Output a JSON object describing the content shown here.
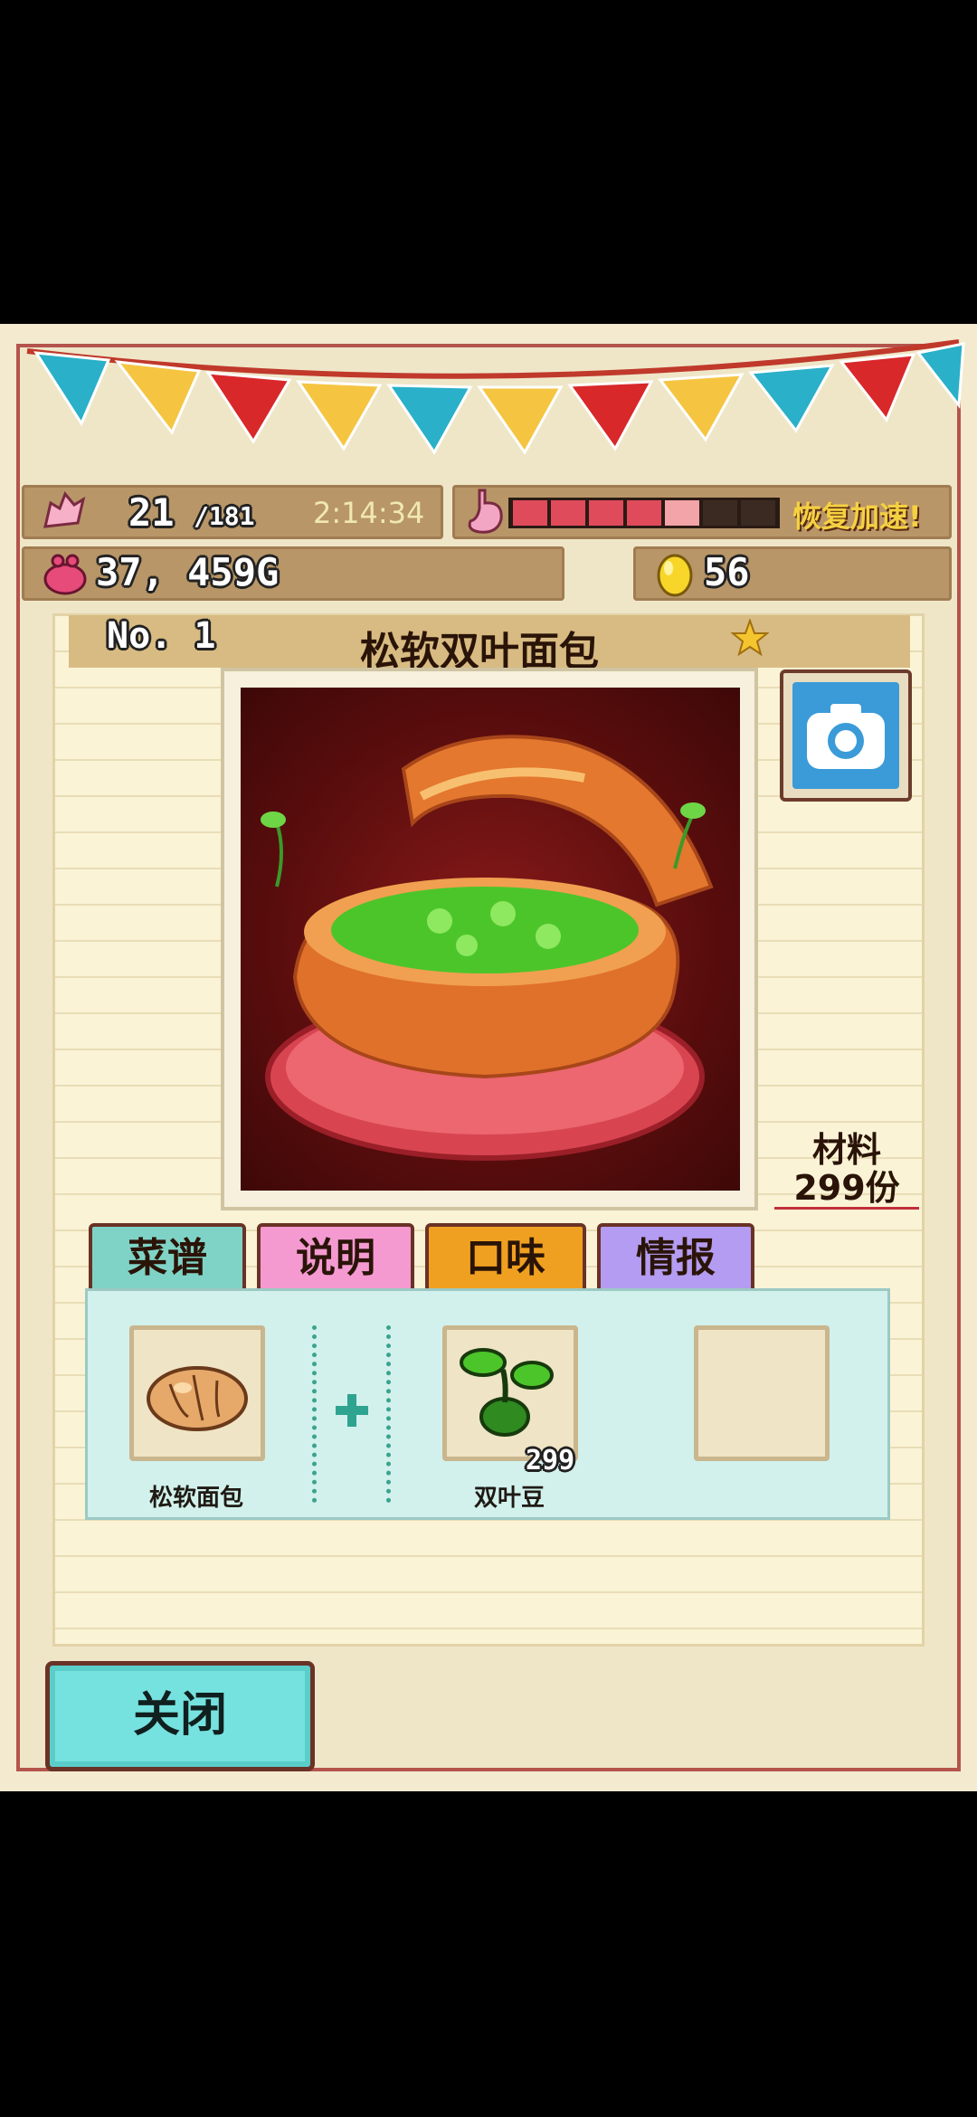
{
  "status": {
    "stamina_current": "21",
    "stamina_max": "/181",
    "timer": "2:14:34",
    "stomach_label": "恢复加速!",
    "stomach_level": 0.75,
    "money": "37, 459G",
    "eggs": "56"
  },
  "recipe": {
    "number": "No. 1",
    "name": "松软双叶面包",
    "materials_label": "材料",
    "materials_count": "299份"
  },
  "tabs": [
    {
      "label": "菜谱",
      "color": "#7fd3c6"
    },
    {
      "label": "说明",
      "color": "#f49ad1"
    },
    {
      "label": "口味",
      "color": "#f0a020"
    },
    {
      "label": "情报",
      "color": "#b49cf2"
    }
  ],
  "ingredients": {
    "slot1_label": "松软面包",
    "slot2_label": "双叶豆",
    "slot2_count": "299"
  },
  "close_label": "关闭",
  "colors": {
    "accent_red": "#b4544c",
    "panel_bg": "#fbf3d6",
    "button_teal": "#76e2df"
  }
}
